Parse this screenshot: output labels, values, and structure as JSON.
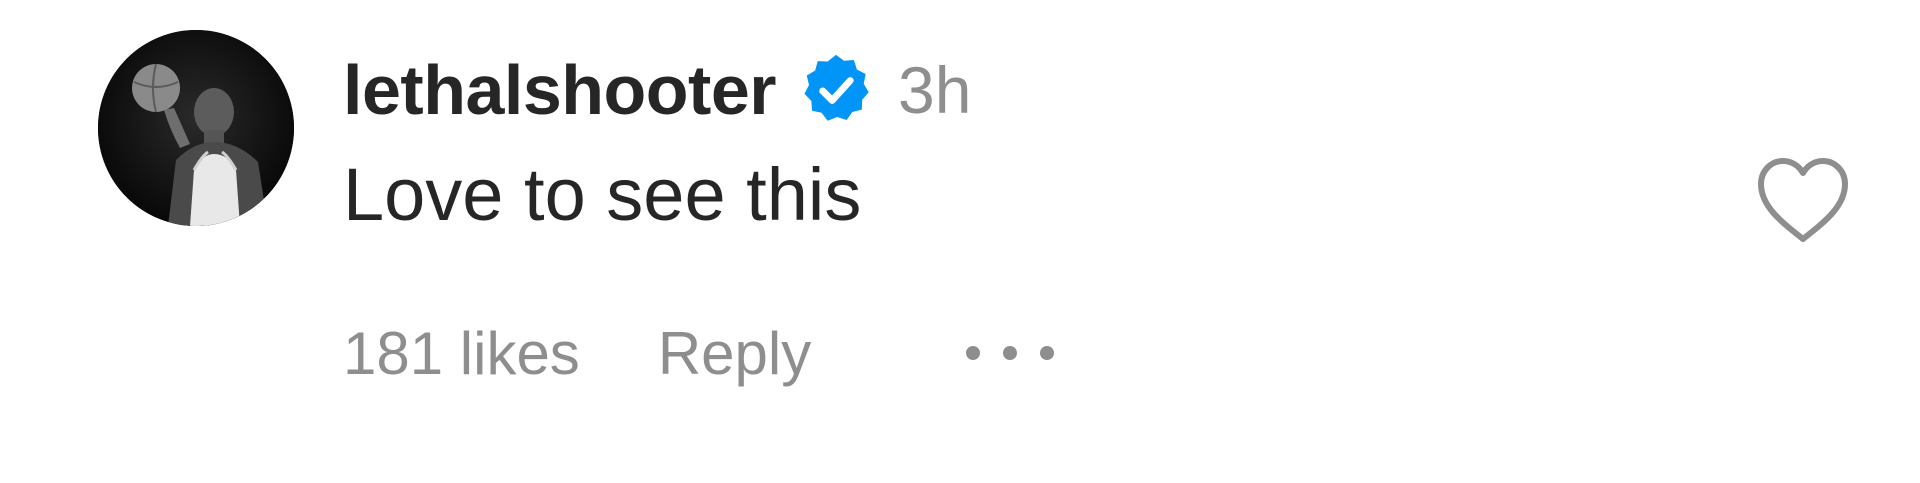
{
  "comment": {
    "username": "lethalshooter",
    "verified_icon": "verified-badge-icon",
    "time": "3h",
    "text": "Love to see this",
    "likes": "181 likes",
    "reply_label": "Reply",
    "more_icon": "more-options-icon",
    "like_icon": "heart-outline-icon",
    "avatar": "profile-photo"
  },
  "colors": {
    "text_primary": "#262626",
    "text_secondary": "#8e8e8e",
    "verified_blue": "#0095f6",
    "background": "#ffffff"
  }
}
